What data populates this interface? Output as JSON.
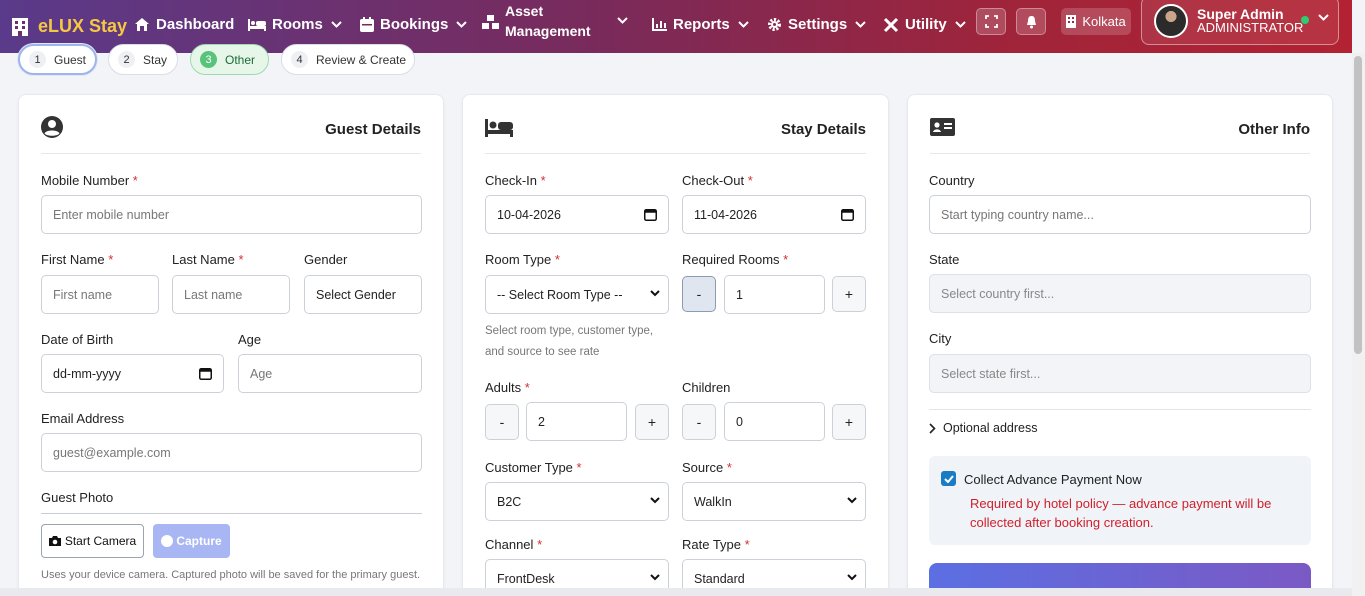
{
  "brand": {
    "name": "eLUX Stay"
  },
  "nav": {
    "dashboard": "Dashboard",
    "rooms": "Rooms",
    "bookings": "Bookings",
    "asset": "Asset Management",
    "reports": "Reports",
    "settings": "Settings",
    "utility": "Utility",
    "location": "Kolkata"
  },
  "user": {
    "name": "Super Admin",
    "role": "ADMINISTRATOR"
  },
  "steps": [
    {
      "num": "1",
      "label": "Guest"
    },
    {
      "num": "2",
      "label": "Stay"
    },
    {
      "num": "3",
      "label": "Other"
    },
    {
      "num": "4",
      "label": "Review & Create"
    }
  ],
  "guest": {
    "title": "Guest Details",
    "mobile_label": "Mobile Number",
    "mobile_placeholder": "Enter mobile number",
    "first_label": "First Name",
    "first_placeholder": "First name",
    "last_label": "Last Name",
    "last_placeholder": "Last name",
    "gender_label": "Gender",
    "gender_value": "Select Gender",
    "dob_label": "Date of Birth",
    "dob_value": "dd-mm-yyyy",
    "age_label": "Age",
    "age_placeholder": "Age",
    "email_label": "Email Address",
    "email_placeholder": "guest@example.com",
    "photo_label": "Guest Photo",
    "start_camera": "Start Camera",
    "capture": "Capture",
    "photo_hint": "Uses your device camera. Captured photo will be saved for the primary guest."
  },
  "stay": {
    "title": "Stay Details",
    "checkin_label": "Check-In",
    "checkin_value": "10-04-2026",
    "checkout_label": "Check-Out",
    "checkout_value": "11-04-2026",
    "room_type_label": "Room Type",
    "room_type_value": "-- Select Room Type --",
    "req_rooms_label": "Required Rooms",
    "req_rooms_value": "1",
    "rate_hint": "Select room type, customer type, and source to see rate",
    "adults_label": "Adults",
    "adults_value": "2",
    "children_label": "Children",
    "children_value": "0",
    "customer_type_label": "Customer Type",
    "customer_type_value": "B2C",
    "source_label": "Source",
    "source_value": "WalkIn",
    "channel_label": "Channel",
    "channel_value": "FrontDesk",
    "rate_type_label": "Rate Type",
    "rate_type_value": "Standard",
    "minus": "-",
    "plus": "+"
  },
  "other": {
    "title": "Other Info",
    "country_label": "Country",
    "country_placeholder": "Start typing country name...",
    "state_label": "State",
    "state_placeholder": "Select country first...",
    "city_label": "City",
    "city_placeholder": "Select state first...",
    "optional_address": "Optional address",
    "advance_label": "Collect Advance Payment Now",
    "advance_checked": true,
    "advance_note": "Required by hotel policy — advance payment will be collected after booking creation."
  },
  "required_mark": "*"
}
